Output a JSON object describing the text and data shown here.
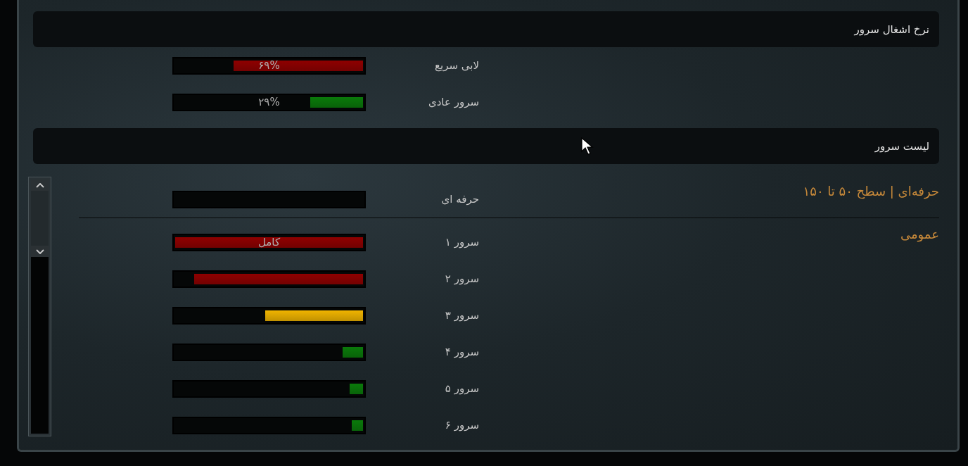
{
  "occupancy": {
    "title": "نرخ اشغال سرور",
    "rows": [
      {
        "label": "لابی سریع",
        "level": 0.69,
        "color": "#8f0000",
        "reading": "۶۹%"
      },
      {
        "label": "سرور عادی",
        "level": 0.28,
        "color": "#0a7a0a",
        "reading": "۲۹%"
      }
    ]
  },
  "server_list": {
    "title": "لیست سرور",
    "groups": [
      {
        "title": "حرفه‌ای | سطح ۵۰ تا ۱۵۰",
        "rows": [
          {
            "label": "حرفه ای"
          }
        ]
      },
      {
        "title": "عمومی",
        "rows": [
          {
            "label": "سرور ۱",
            "level": 1,
            "color": "#8f0000",
            "reading": "کامل"
          },
          {
            "label": "سرور ۲",
            "level": 0.9,
            "color": "#8f0000"
          },
          {
            "label": "سرور ۳",
            "level": 0.52,
            "color": "#f0b400"
          },
          {
            "label": "سرور ۴",
            "level": 0.11,
            "color": "#0a7a0a"
          },
          {
            "label": "سرور ۵",
            "level": 0.07,
            "color": "#0a7a0a"
          },
          {
            "label": "سرور ۶",
            "level": 0.06,
            "color": "#0a7a0a"
          }
        ]
      }
    ]
  }
}
